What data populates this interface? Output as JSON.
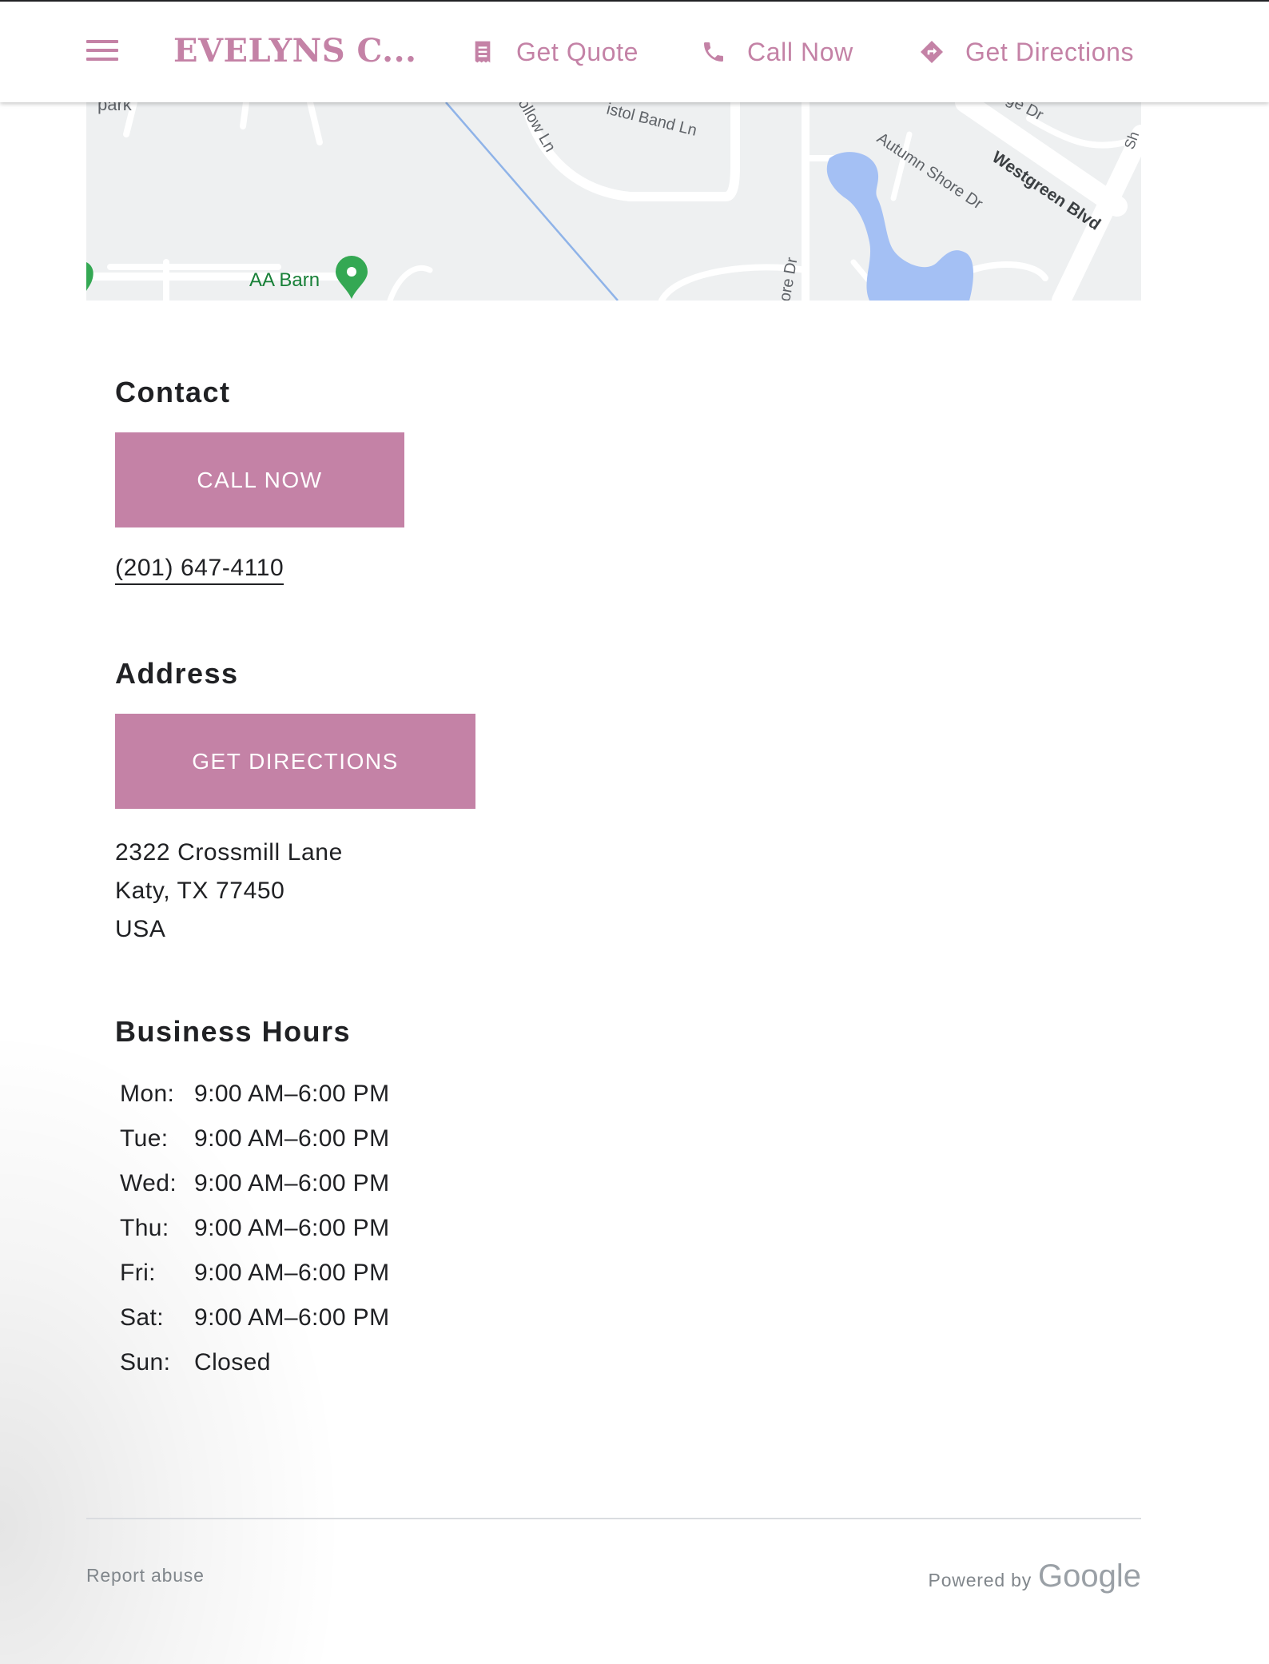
{
  "header": {
    "menu_label": "menu",
    "brand": "EVELYNS C...",
    "actions": [
      {
        "label": "Get Quote",
        "icon": "receipt-icon"
      },
      {
        "label": "Call Now",
        "icon": "phone-icon"
      },
      {
        "label": "Get Directions",
        "icon": "directions-icon"
      }
    ]
  },
  "map": {
    "labels": {
      "park": "park",
      "hollow": "ollow Ln",
      "bristol": "istol Band Ln",
      "ridge": "ge Dr",
      "autumn": "Autumn Shore Dr",
      "westgreen": "Westgreen Blvd",
      "shore": "ore Dr",
      "poi": "AA Barn",
      "edge": "Sh"
    }
  },
  "contact": {
    "title": "Contact",
    "button": "CALL NOW",
    "phone": "(201) 647-4110"
  },
  "address": {
    "title": "Address",
    "button": "GET DIRECTIONS",
    "lines": [
      "2322 Crossmill Lane",
      "Katy, TX 77450",
      "USA"
    ]
  },
  "hours": {
    "title": "Business Hours",
    "rows": [
      {
        "day": "Mon:",
        "time": "9:00 AM–6:00 PM"
      },
      {
        "day": "Tue:",
        "time": "9:00 AM–6:00 PM"
      },
      {
        "day": "Wed:",
        "time": "9:00 AM–6:00 PM"
      },
      {
        "day": "Thu:",
        "time": "9:00 AM–6:00 PM"
      },
      {
        "day": "Fri:",
        "time": "9:00 AM–6:00 PM"
      },
      {
        "day": "Sat:",
        "time": "9:00 AM–6:00 PM"
      },
      {
        "day": "Sun:",
        "time": "Closed"
      }
    ]
  },
  "footer": {
    "report": "Report abuse",
    "powered_by": "Powered by",
    "google": "Google"
  },
  "colors": {
    "accent": "#c482a6",
    "text": "#202124",
    "muted": "#80868b",
    "map_bg": "#eef0f1",
    "water": "#a4c0f4",
    "poi": "#34a853"
  }
}
